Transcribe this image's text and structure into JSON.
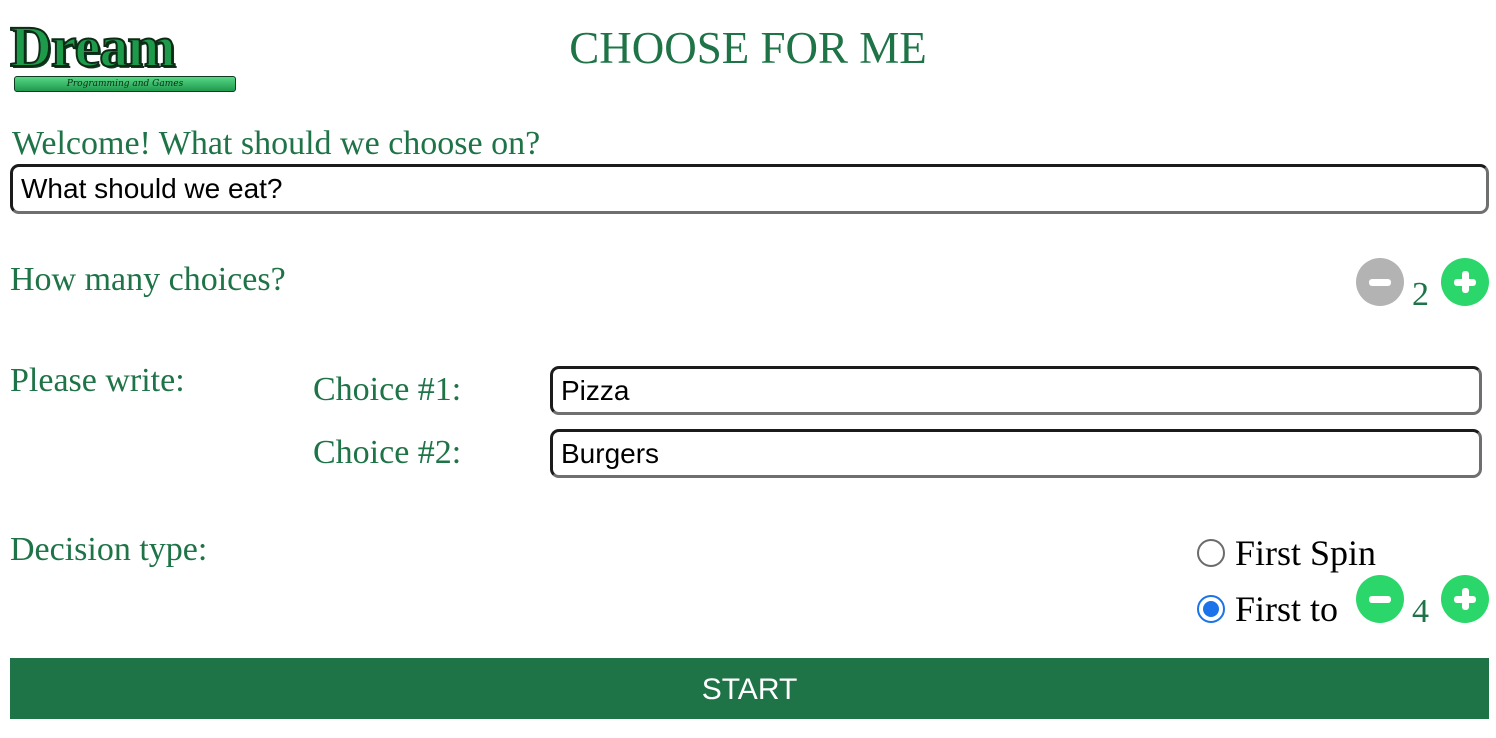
{
  "logo": {
    "word": "Dream",
    "tagline": "Programming and Games"
  },
  "title": "CHOOSE FOR ME",
  "question": {
    "label": "Welcome! What should we choose on?",
    "value": "What should we eat?"
  },
  "choices_count": {
    "label": "How many choices?",
    "value": "2",
    "minus_enabled": false,
    "plus_enabled": true
  },
  "choices": {
    "label": "Please write:",
    "items": [
      {
        "label": "Choice #1:",
        "value": "Pizza"
      },
      {
        "label": "Choice #2:",
        "value": "Burgers"
      }
    ]
  },
  "decision": {
    "label": "Decision type:",
    "options": [
      {
        "label": "First Spin",
        "selected": false
      },
      {
        "label": "First to",
        "selected": true
      }
    ],
    "first_to_value": "4"
  },
  "start_label": "START",
  "colors": {
    "primary": "#1e7347",
    "accent_green": "#2bd76a",
    "disabled_gray": "#b3b3b3",
    "radio_blue": "#1a73e8"
  }
}
